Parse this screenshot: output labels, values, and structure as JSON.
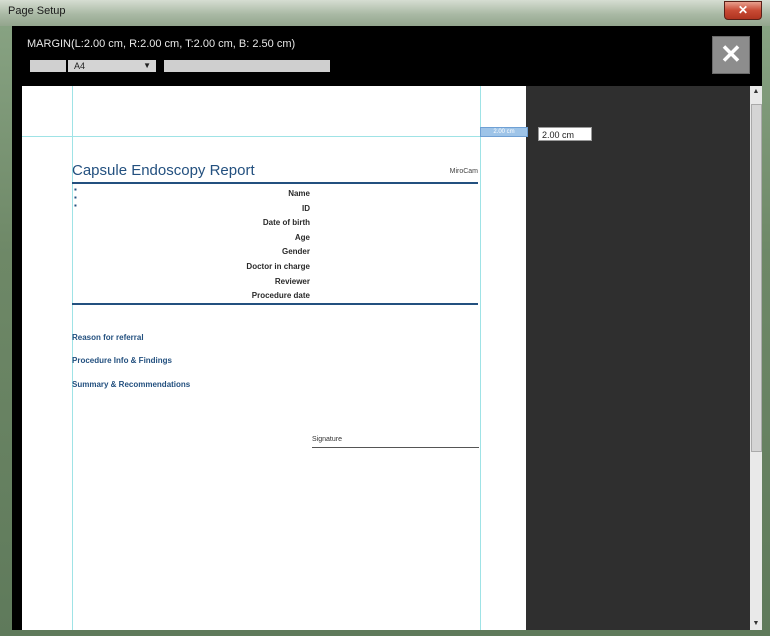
{
  "window": {
    "title": "Page Setup",
    "close_glyph": "✕"
  },
  "toolbar": {
    "margin_info": "MARGIN(L:2.00 cm, R:2.00 cm, T:2.00 cm, B: 2.50 cm)",
    "paper_size": "A4",
    "dropdown_arrow": "▼",
    "close_glyph": "✕"
  },
  "margin_edit": {
    "marker": "2.00 cm",
    "value": "2.00 cm"
  },
  "report": {
    "title": "Capsule Endoscopy Report",
    "brand": "MiroCam",
    "fields": [
      "Name",
      "ID",
      "Date of birth",
      "Age",
      "Gender",
      "Doctor in charge",
      "Reviewer",
      "Procedure date"
    ],
    "sections": [
      "Reason for referral",
      "Procedure Info & Findings",
      "Summary & Recommendations"
    ],
    "signature_label": "Signature"
  },
  "scrollbar": {
    "up_glyph": "▲",
    "down_glyph": "▼"
  },
  "colors": {
    "accent": "#23507f",
    "guide": "#9fe3e6",
    "window_bg": "#000000",
    "preview_bg": "#2f2f2f"
  }
}
